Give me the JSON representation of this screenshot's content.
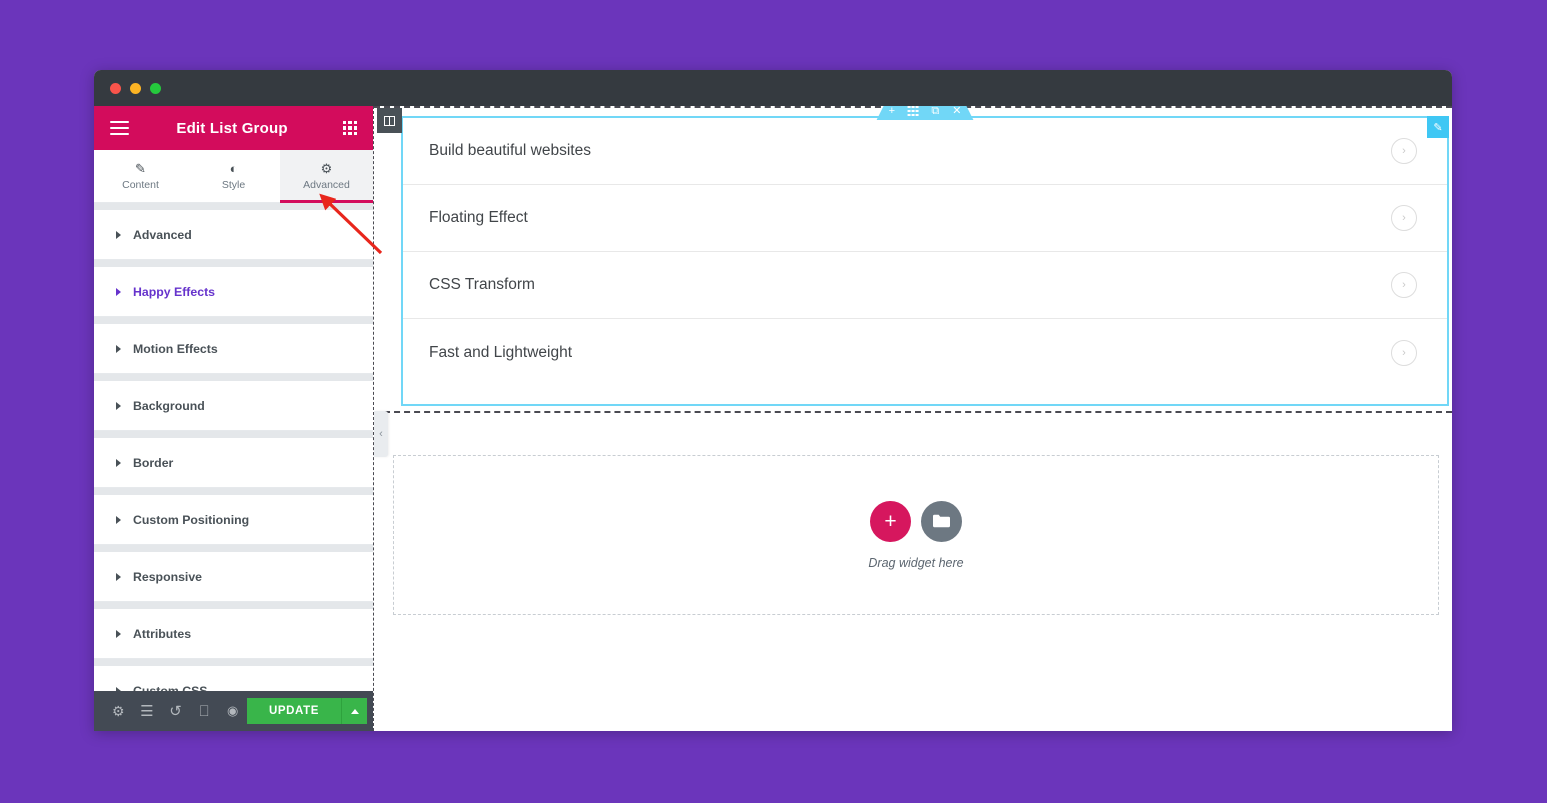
{
  "window": {
    "traffic_lights": [
      {
        "name": "close",
        "color": "#f9544b"
      },
      {
        "name": "minimize",
        "color": "#fcb424"
      },
      {
        "name": "maximize",
        "color": "#25c93d"
      }
    ]
  },
  "panel": {
    "header": {
      "menu_icon": "hamburger-icon",
      "title": "Edit List Group",
      "grid_icon": "widgets-grid-icon",
      "bg_color": "#d30c5c"
    },
    "tabs": [
      {
        "label": "Content",
        "icon": "pencil-icon",
        "glyph": "✎",
        "active": false
      },
      {
        "label": "Style",
        "icon": "contrast-icon",
        "glyph": "◐",
        "active": false
      },
      {
        "label": "Advanced",
        "icon": "gear-icon",
        "glyph": "⚙",
        "active": true
      }
    ],
    "sections": [
      {
        "label": "Advanced",
        "highlight": false
      },
      {
        "label": "Happy Effects",
        "highlight": true
      },
      {
        "label": "Motion Effects",
        "highlight": false
      },
      {
        "label": "Background",
        "highlight": false
      },
      {
        "label": "Border",
        "highlight": false
      },
      {
        "label": "Custom Positioning",
        "highlight": false
      },
      {
        "label": "Responsive",
        "highlight": false
      },
      {
        "label": "Attributes",
        "highlight": false
      },
      {
        "label": "Custom CSS",
        "highlight": false
      }
    ],
    "highlight_color": "#6633cc",
    "footer": {
      "icons": [
        {
          "name": "settings-gear-icon",
          "glyph": "⚙"
        },
        {
          "name": "navigator-layers-icon",
          "glyph": "≣"
        },
        {
          "name": "history-icon",
          "glyph": "↺"
        },
        {
          "name": "responsive-mode-icon",
          "glyph": "▢"
        },
        {
          "name": "preview-eye-icon",
          "glyph": "◉"
        }
      ],
      "update_label": "UPDATE",
      "update_color": "#39b54a"
    }
  },
  "canvas": {
    "navigator_toggle_icon": "panel-columns-icon",
    "collapse_handle_icon": "chevron-left-icon",
    "collapse_glyph": "‹",
    "section_toolbar": [
      {
        "name": "add-section-icon",
        "glyph": "+"
      },
      {
        "name": "section-grid-icon",
        "glyph": "grid"
      },
      {
        "name": "duplicate-section-icon",
        "glyph": "⧉"
      },
      {
        "name": "delete-section-icon",
        "glyph": "✕"
      }
    ],
    "section_accent_color": "#71d7f7",
    "edit_badge_icon": "pencil-edit-icon",
    "edit_badge_glyph": "✎",
    "list_items": [
      {
        "text": "Build beautiful websites",
        "chevron": "chevron-right-icon",
        "glyph": "›"
      },
      {
        "text": "Floating Effect",
        "chevron": "chevron-right-icon",
        "glyph": "›"
      },
      {
        "text": "CSS Transform",
        "chevron": "chevron-right-icon",
        "glyph": "›"
      },
      {
        "text": "Fast and Lightweight",
        "chevron": "chevron-right-icon",
        "glyph": "›"
      }
    ],
    "drop_zone": {
      "add_icon": "plus-icon",
      "add_glyph": "+",
      "folder_icon": "folder-template-icon",
      "folder_glyph": "▰",
      "label": "Drag widget here"
    }
  },
  "annotation": {
    "arrow_color": "#e8261c"
  }
}
